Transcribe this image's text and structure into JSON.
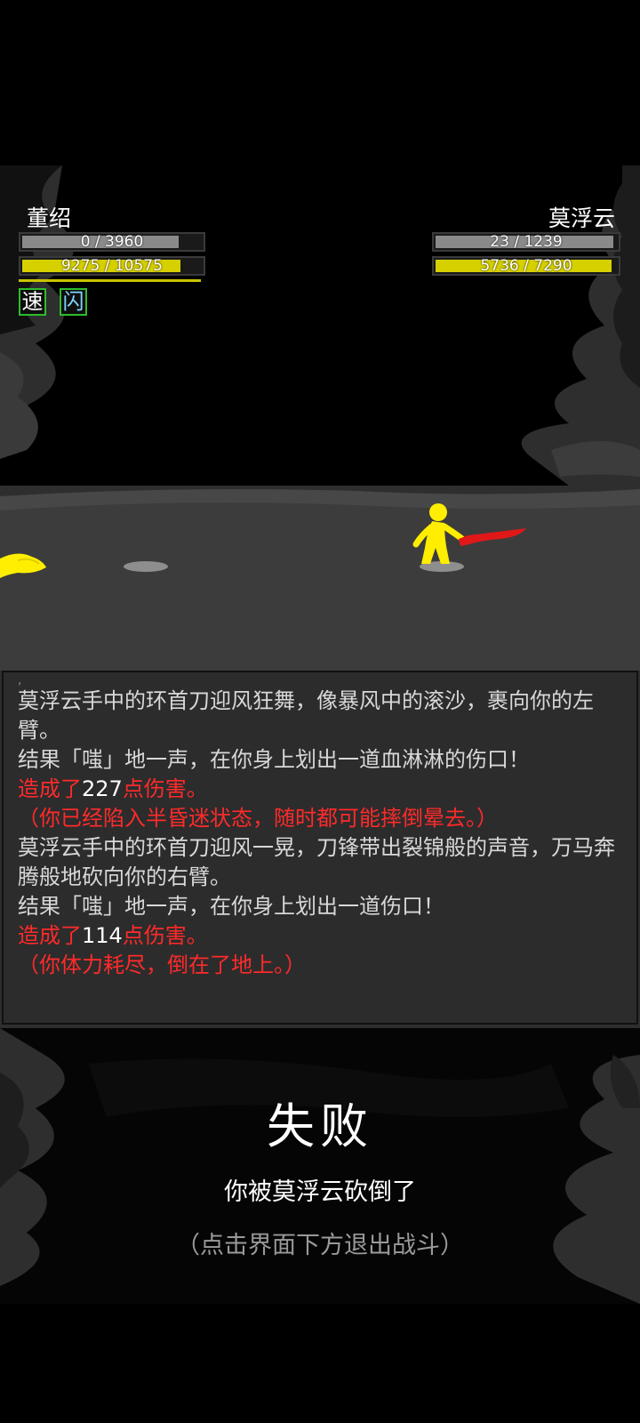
{
  "player": {
    "name": "董绍",
    "hp_text": "0 / 3960",
    "hp_fraction": 0.87,
    "mp_text": "9275 / 10575",
    "mp_fraction": 0.88,
    "buffs": [
      "速",
      "闪"
    ],
    "colors": {
      "hp": "#8a8a8a",
      "mp": "#d6d000",
      "buff_border": "#2cbd2c"
    }
  },
  "enemy": {
    "name": "莫浮云",
    "hp_text": "23 / 1239",
    "hp_fraction": 0.98,
    "mp_text": "5736 / 7290",
    "mp_fraction": 0.97,
    "colors": {
      "hp": "#8a8a8a",
      "mp": "#d6d000",
      "weapon": "#e01818",
      "body": "#ffee00"
    }
  },
  "log": {
    "tick": ",",
    "lines": [
      {
        "segments": [
          {
            "text": "莫浮云手中的环首刀迎风狂舞，像暴风中的滚沙，裹向你的左臂。",
            "style": "normal"
          }
        ]
      },
      {
        "segments": [
          {
            "text": "结果「嗤」地一声，在你身上划出一道血淋淋的伤口！",
            "style": "normal"
          }
        ]
      },
      {
        "segments": [
          {
            "text": "造成了",
            "style": "red"
          },
          {
            "text": "227",
            "style": "white"
          },
          {
            "text": "点伤害。",
            "style": "red"
          }
        ]
      },
      {
        "segments": [
          {
            "text": "（你已经陷入半昏迷状态，随时都可能摔倒晕去。）",
            "style": "red"
          }
        ]
      },
      {
        "segments": [
          {
            "text": "莫浮云手中的环首刀迎风一晃，刀锋带出裂锦般的声音，万马奔腾般地砍向你的右臂。",
            "style": "normal"
          }
        ]
      },
      {
        "segments": [
          {
            "text": "结果「嗤」地一声，在你身上划出一道伤口！",
            "style": "normal"
          }
        ]
      },
      {
        "segments": [
          {
            "text": "造成了",
            "style": "red"
          },
          {
            "text": "114",
            "style": "white"
          },
          {
            "text": "点伤害。",
            "style": "red"
          }
        ]
      },
      {
        "segments": [
          {
            "text": "（你体力耗尽，倒在了地上。）",
            "style": "red"
          }
        ]
      }
    ]
  },
  "result": {
    "title": "失败",
    "message": "你被莫浮云砍倒了",
    "hint": "（点击界面下方退出战斗）"
  }
}
